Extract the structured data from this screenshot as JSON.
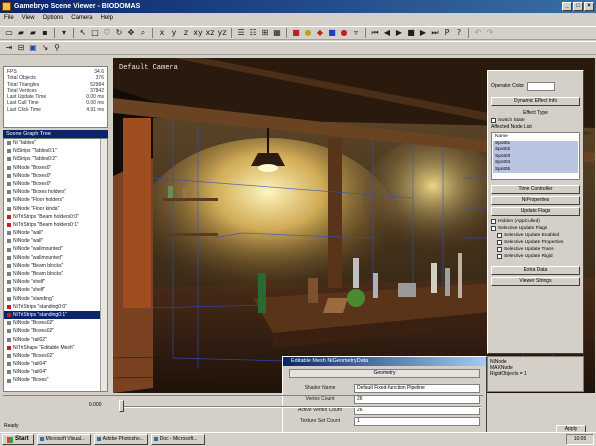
{
  "window": {
    "title": "Gamebryo Scene Viewer - BIODOMAS"
  },
  "menu": [
    "File",
    "View",
    "Options",
    "Camera",
    "Help"
  ],
  "stats": [
    {
      "label": "FPS",
      "value": "34.6"
    },
    {
      "label": "Total Objects",
      "value": "376"
    },
    {
      "label": "Total Triangles",
      "value": "52984"
    },
    {
      "label": "Total Vertices",
      "value": "37842"
    },
    {
      "label": "Last Update Time",
      "value": "0.00 ms"
    },
    {
      "label": "Last Cull Time",
      "value": "0.00 ms"
    },
    {
      "label": "Last Click Time",
      "value": "4.91 ms"
    }
  ],
  "tree": {
    "header": "Scene Graph Tree",
    "items": [
      {
        "label": "Ni \"tables\"",
        "selected": false,
        "red": false
      },
      {
        "label": "NiStrips \"Tables0:1\"",
        "selected": false,
        "red": false
      },
      {
        "label": "NiStrips \"Tables0:2\"",
        "selected": false,
        "red": false
      },
      {
        "label": "NiNode \"Boxes0\"",
        "selected": false,
        "red": false
      },
      {
        "label": "NiNode \"Boxes0\"",
        "selected": false,
        "red": false
      },
      {
        "label": "NiNode \"Boxes0\"",
        "selected": false,
        "red": false
      },
      {
        "label": "NiNode \"Boxes holders\"",
        "selected": false,
        "red": false
      },
      {
        "label": "NiNode \"Floor holders\"",
        "selected": false,
        "red": false
      },
      {
        "label": "NiNode \"Floor kinda\"",
        "selected": false,
        "red": false
      },
      {
        "label": "NiTriStrips \"Beam holders0:0\"",
        "selected": false,
        "red": true
      },
      {
        "label": "NiTriStrips \"Beam holders0:1\"",
        "selected": false,
        "red": true
      },
      {
        "label": "NiNode \"wall\"",
        "selected": false,
        "red": false
      },
      {
        "label": "NiNode \"wall\"",
        "selected": false,
        "red": false
      },
      {
        "label": "NiNode \"wallmounted\"",
        "selected": false,
        "red": false
      },
      {
        "label": "NiNode \"wallmounted\"",
        "selected": false,
        "red": false
      },
      {
        "label": "NiNode \"Beam blocks\"",
        "selected": false,
        "red": false
      },
      {
        "label": "NiNode \"Beam blocks\"",
        "selected": false,
        "red": false
      },
      {
        "label": "NiNode \"shelf\"",
        "selected": false,
        "red": false
      },
      {
        "label": "NiNode \"shelf\"",
        "selected": false,
        "red": false
      },
      {
        "label": "NiNode \"standing\"",
        "selected": false,
        "red": false
      },
      {
        "label": "NiTriStrips \"standing0:0\"",
        "selected": false,
        "red": true
      },
      {
        "label": "NiTriStrips \"standing0:1\"",
        "selected": true,
        "red": true
      },
      {
        "label": "NiNode \"Boxes02\"",
        "selected": false,
        "red": false
      },
      {
        "label": "NiNode \"Boxes02\"",
        "selected": false,
        "red": false
      },
      {
        "label": "NiNode \"rail02\"",
        "selected": false,
        "red": false
      },
      {
        "label": "NiTriShape \"Editable Mesh\"",
        "selected": false,
        "red": true
      },
      {
        "label": "NiNode \"Boxes02\"",
        "selected": false,
        "red": false
      },
      {
        "label": "NiNode \"rail04\"",
        "selected": false,
        "red": false
      },
      {
        "label": "NiNode \"rail04\"",
        "selected": false,
        "red": false
      },
      {
        "label": "NiNode \"Boxes\"",
        "selected": false,
        "red": false
      }
    ]
  },
  "viewport": {
    "camera_label": "Default Camera"
  },
  "properties": {
    "operator_label": "Operator Color",
    "dynamic_effect_button": "Dynamic Effect Info",
    "effect_type_label": "Effect Type",
    "switch_state_label": "Switch State",
    "affected_label": "Affected Node List",
    "list_header": "Name",
    "list_items": [
      "Spot01",
      "Spot02",
      "Spot03",
      "Spot04",
      "Spot05"
    ],
    "time_controller_button": "Time Controller",
    "niproperties_button": "NiProperties",
    "update_flags_button": "Update Flags",
    "hidden_label": "Hidden (AppCulled)",
    "selective_flags_label": "Selective Update Flags",
    "selective_items": [
      "Selective Update Enabled",
      "Selective Update Properties",
      "Selective Update Trans",
      "Selective Update Rigid"
    ],
    "extra_data_button": "Extra Data",
    "viewer_strings_button": "Viewer Strings"
  },
  "right2": {
    "lines": [
      "NiNode",
      "MAXNode",
      "RigidObjects = 1"
    ]
  },
  "dialog": {
    "title": "Editable Mesh NiGeometryData",
    "tab": "Geometry",
    "rows": [
      {
        "label": "Shader Name",
        "value": "Default Fixed-function Pipeline"
      },
      {
        "label": "Vertex Count",
        "value": "26"
      },
      {
        "label": "Active Vertex Count",
        "value": "26"
      },
      {
        "label": "Texture Set Count",
        "value": "1"
      }
    ]
  },
  "timeline": {
    "value": "0.000"
  },
  "apply_label": "Apply",
  "status": {
    "text": "Ready"
  },
  "taskbar": {
    "start": "Start",
    "tasks": [
      "Microsoft Visual...",
      "Adobe Photosho...",
      "Doc - Microsoft..."
    ],
    "clock": "10:05"
  },
  "colors": {
    "titlebar": "#0a246a",
    "selection": "#0a246a",
    "panel": "#d4d0c8"
  }
}
